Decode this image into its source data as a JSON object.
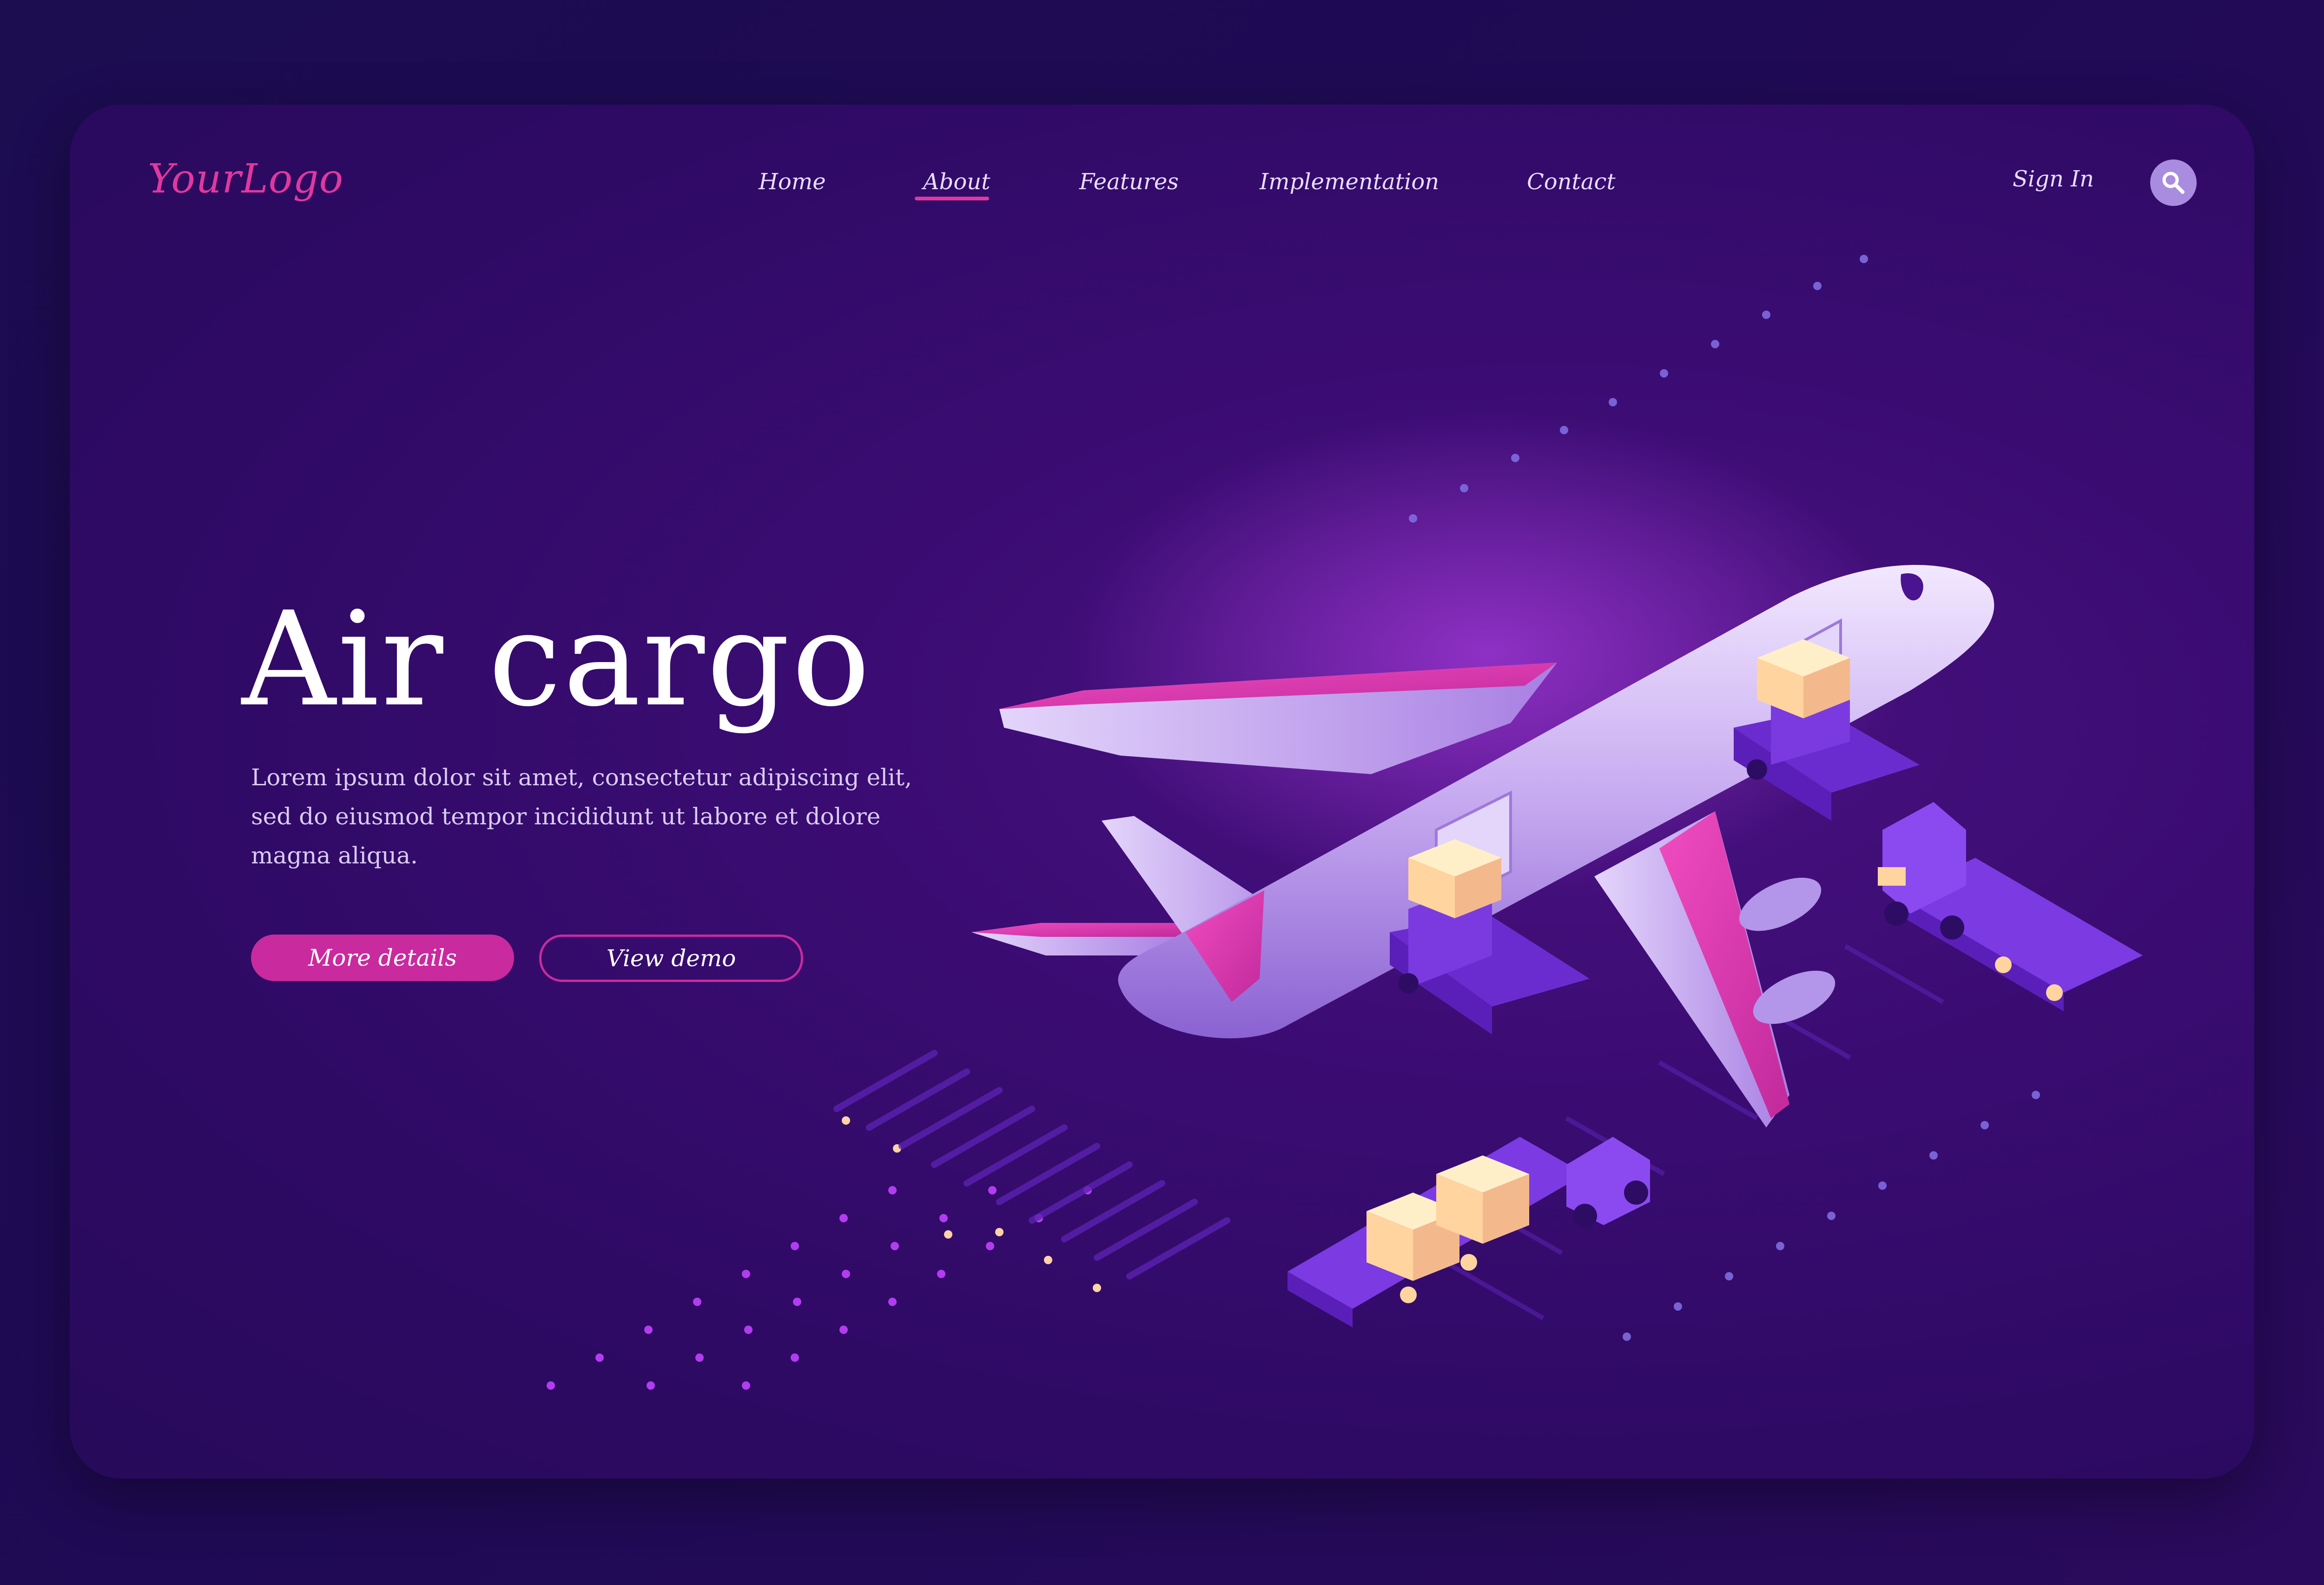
{
  "header": {
    "logo": "YourLogo",
    "nav": [
      {
        "label": "Home",
        "active": false
      },
      {
        "label": "About",
        "active": true
      },
      {
        "label": "Features",
        "active": false
      },
      {
        "label": "Implementation",
        "active": false
      },
      {
        "label": "Contact",
        "active": false
      }
    ],
    "sign_in": "Sign In",
    "search_icon": "search-icon"
  },
  "hero": {
    "title": "Air cargo",
    "description": "Lorem ipsum dolor sit amet, consectetur adipiscing elit, sed do eiusmod tempor incididunt ut labore et dolore magna aliqua.",
    "primary_button": "More details",
    "secondary_button": "View demo"
  },
  "illustration": {
    "subject": "cargo-airplane",
    "objects": [
      "airplane-icon",
      "cargo-box-icon",
      "loader-truck-icon",
      "cargo-trailer-icon"
    ]
  },
  "colors": {
    "accent": "#e0389e",
    "button": "#c92a9e",
    "background": "#2e0a64",
    "outer_background": "#1c0c50",
    "text": "#ffffff"
  }
}
